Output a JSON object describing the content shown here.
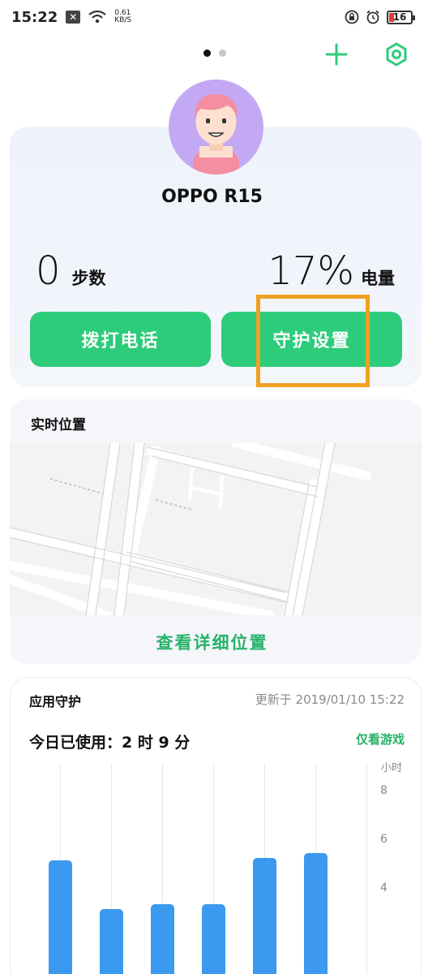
{
  "status_bar": {
    "time": "15:22",
    "net_speed_value": "0.61",
    "net_speed_unit": "KB/S",
    "battery": "16"
  },
  "header": {
    "pager_pages": 2,
    "pager_active": 0
  },
  "profile": {
    "device_name": "OPPO R15",
    "steps_value": "0",
    "steps_label": "步数",
    "battery_value": "17%",
    "battery_label": "电量",
    "call_button": "拨打电话",
    "guard_settings_button": "守护设置"
  },
  "location": {
    "title": "实时位置",
    "details_link": "查看详细位置"
  },
  "app_guard": {
    "title": "应用守护",
    "updated": "更新于 2019/01/10 15:22",
    "usage_today": "今日已使用：2 时 9 分",
    "games_only": "仅看游戏"
  },
  "chart_data": {
    "type": "bar",
    "ylabel": "小时",
    "yticks": [
      "8",
      "6",
      "4"
    ],
    "ylim": [
      0,
      8
    ],
    "values": [
      5.1,
      3.1,
      3.3,
      3.3,
      5.2,
      5.4
    ],
    "bar_color": "#3b99ef"
  },
  "colors": {
    "accent_green": "#2dcc7b",
    "highlight_orange": "#f0a023"
  }
}
